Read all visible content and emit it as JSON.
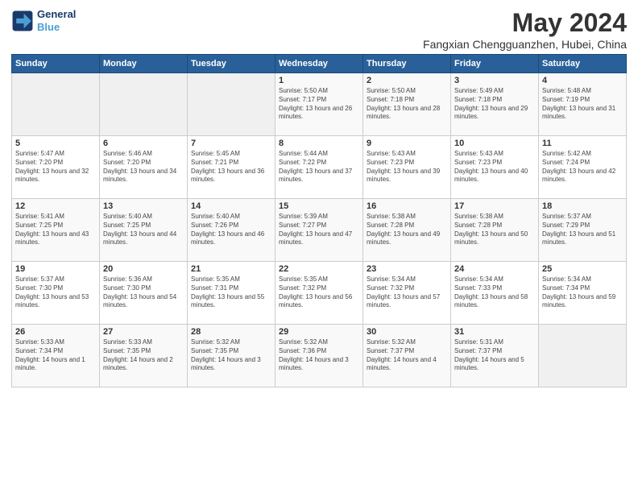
{
  "header": {
    "logo_line1": "General",
    "logo_line2": "Blue",
    "title": "May 2024",
    "subtitle": "Fangxian Chengguanzhen, Hubei, China"
  },
  "weekdays": [
    "Sunday",
    "Monday",
    "Tuesday",
    "Wednesday",
    "Thursday",
    "Friday",
    "Saturday"
  ],
  "weeks": [
    [
      {
        "day": "",
        "text": ""
      },
      {
        "day": "",
        "text": ""
      },
      {
        "day": "",
        "text": ""
      },
      {
        "day": "1",
        "text": "Sunrise: 5:50 AM\nSunset: 7:17 PM\nDaylight: 13 hours and 26 minutes."
      },
      {
        "day": "2",
        "text": "Sunrise: 5:50 AM\nSunset: 7:18 PM\nDaylight: 13 hours and 28 minutes."
      },
      {
        "day": "3",
        "text": "Sunrise: 5:49 AM\nSunset: 7:18 PM\nDaylight: 13 hours and 29 minutes."
      },
      {
        "day": "4",
        "text": "Sunrise: 5:48 AM\nSunset: 7:19 PM\nDaylight: 13 hours and 31 minutes."
      }
    ],
    [
      {
        "day": "5",
        "text": "Sunrise: 5:47 AM\nSunset: 7:20 PM\nDaylight: 13 hours and 32 minutes."
      },
      {
        "day": "6",
        "text": "Sunrise: 5:46 AM\nSunset: 7:20 PM\nDaylight: 13 hours and 34 minutes."
      },
      {
        "day": "7",
        "text": "Sunrise: 5:45 AM\nSunset: 7:21 PM\nDaylight: 13 hours and 36 minutes."
      },
      {
        "day": "8",
        "text": "Sunrise: 5:44 AM\nSunset: 7:22 PM\nDaylight: 13 hours and 37 minutes."
      },
      {
        "day": "9",
        "text": "Sunrise: 5:43 AM\nSunset: 7:23 PM\nDaylight: 13 hours and 39 minutes."
      },
      {
        "day": "10",
        "text": "Sunrise: 5:43 AM\nSunset: 7:23 PM\nDaylight: 13 hours and 40 minutes."
      },
      {
        "day": "11",
        "text": "Sunrise: 5:42 AM\nSunset: 7:24 PM\nDaylight: 13 hours and 42 minutes."
      }
    ],
    [
      {
        "day": "12",
        "text": "Sunrise: 5:41 AM\nSunset: 7:25 PM\nDaylight: 13 hours and 43 minutes."
      },
      {
        "day": "13",
        "text": "Sunrise: 5:40 AM\nSunset: 7:25 PM\nDaylight: 13 hours and 44 minutes."
      },
      {
        "day": "14",
        "text": "Sunrise: 5:40 AM\nSunset: 7:26 PM\nDaylight: 13 hours and 46 minutes."
      },
      {
        "day": "15",
        "text": "Sunrise: 5:39 AM\nSunset: 7:27 PM\nDaylight: 13 hours and 47 minutes."
      },
      {
        "day": "16",
        "text": "Sunrise: 5:38 AM\nSunset: 7:28 PM\nDaylight: 13 hours and 49 minutes."
      },
      {
        "day": "17",
        "text": "Sunrise: 5:38 AM\nSunset: 7:28 PM\nDaylight: 13 hours and 50 minutes."
      },
      {
        "day": "18",
        "text": "Sunrise: 5:37 AM\nSunset: 7:29 PM\nDaylight: 13 hours and 51 minutes."
      }
    ],
    [
      {
        "day": "19",
        "text": "Sunrise: 5:37 AM\nSunset: 7:30 PM\nDaylight: 13 hours and 53 minutes."
      },
      {
        "day": "20",
        "text": "Sunrise: 5:36 AM\nSunset: 7:30 PM\nDaylight: 13 hours and 54 minutes."
      },
      {
        "day": "21",
        "text": "Sunrise: 5:35 AM\nSunset: 7:31 PM\nDaylight: 13 hours and 55 minutes."
      },
      {
        "day": "22",
        "text": "Sunrise: 5:35 AM\nSunset: 7:32 PM\nDaylight: 13 hours and 56 minutes."
      },
      {
        "day": "23",
        "text": "Sunrise: 5:34 AM\nSunset: 7:32 PM\nDaylight: 13 hours and 57 minutes."
      },
      {
        "day": "24",
        "text": "Sunrise: 5:34 AM\nSunset: 7:33 PM\nDaylight: 13 hours and 58 minutes."
      },
      {
        "day": "25",
        "text": "Sunrise: 5:34 AM\nSunset: 7:34 PM\nDaylight: 13 hours and 59 minutes."
      }
    ],
    [
      {
        "day": "26",
        "text": "Sunrise: 5:33 AM\nSunset: 7:34 PM\nDaylight: 14 hours and 1 minute."
      },
      {
        "day": "27",
        "text": "Sunrise: 5:33 AM\nSunset: 7:35 PM\nDaylight: 14 hours and 2 minutes."
      },
      {
        "day": "28",
        "text": "Sunrise: 5:32 AM\nSunset: 7:35 PM\nDaylight: 14 hours and 3 minutes."
      },
      {
        "day": "29",
        "text": "Sunrise: 5:32 AM\nSunset: 7:36 PM\nDaylight: 14 hours and 3 minutes."
      },
      {
        "day": "30",
        "text": "Sunrise: 5:32 AM\nSunset: 7:37 PM\nDaylight: 14 hours and 4 minutes."
      },
      {
        "day": "31",
        "text": "Sunrise: 5:31 AM\nSunset: 7:37 PM\nDaylight: 14 hours and 5 minutes."
      },
      {
        "day": "",
        "text": ""
      }
    ]
  ]
}
